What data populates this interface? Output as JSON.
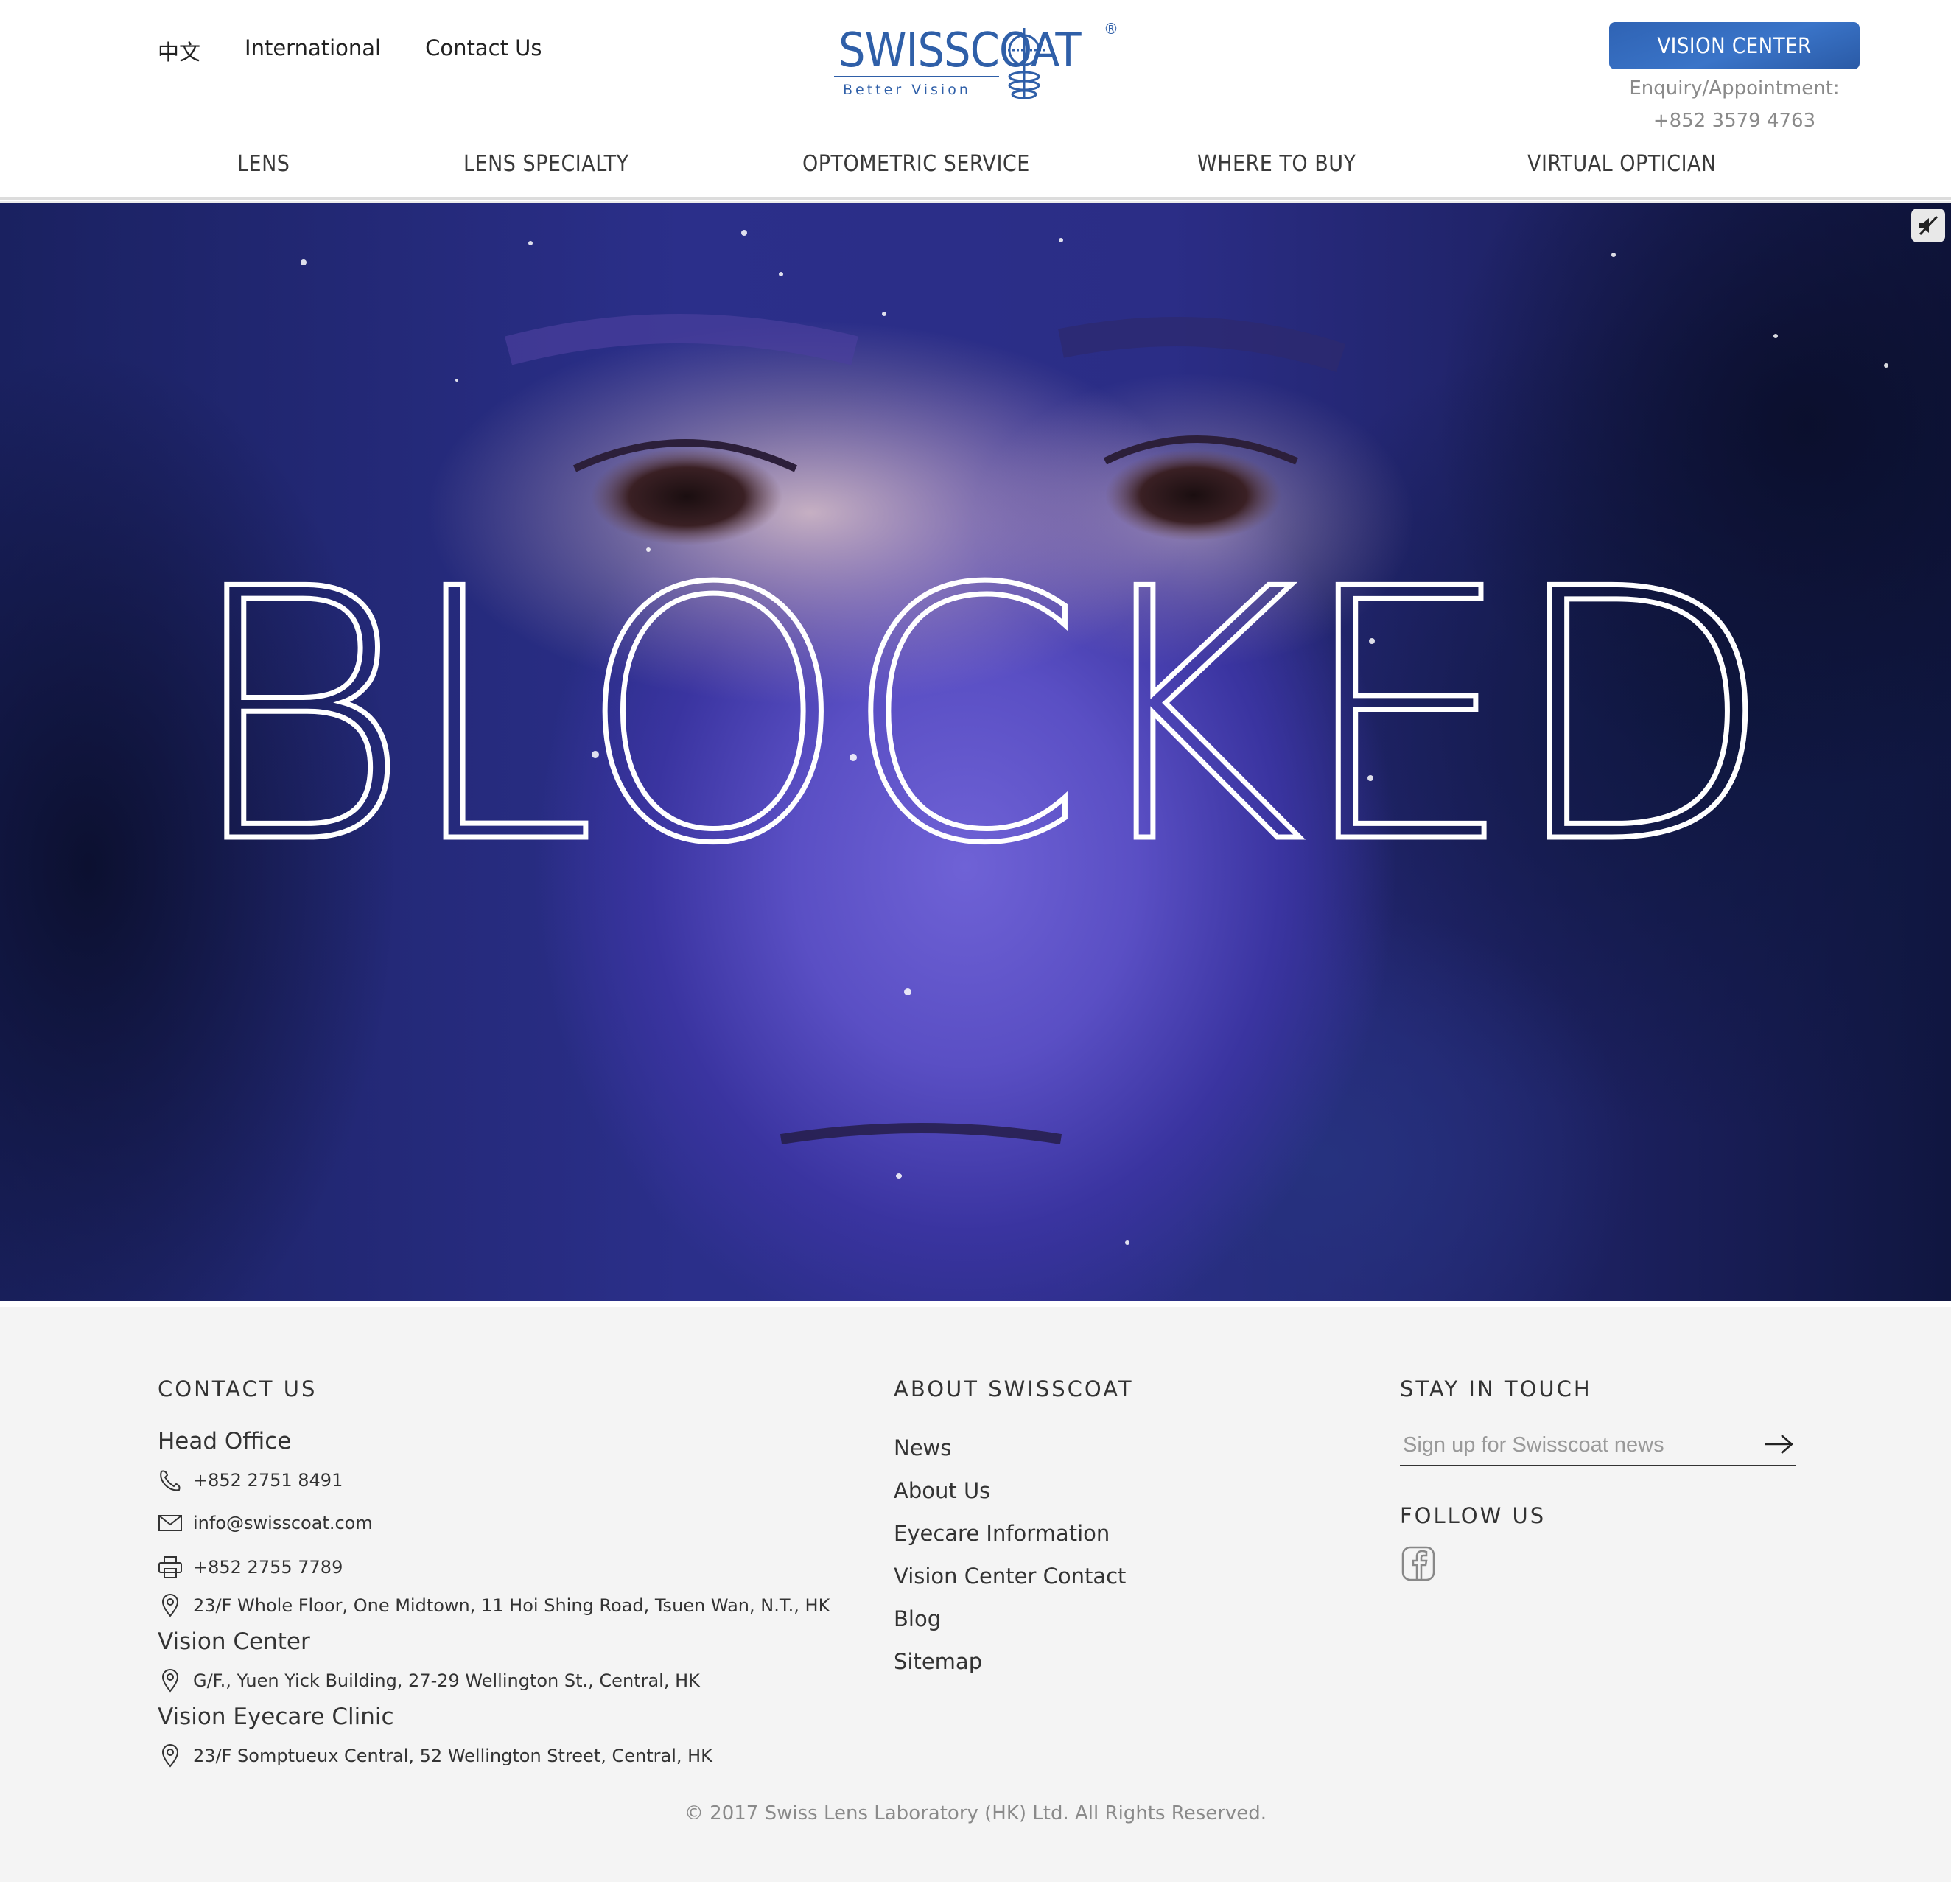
{
  "header": {
    "top_links": [
      "中文",
      "International",
      "Contact Us"
    ],
    "logo": {
      "brand": "SWISSCOAT",
      "tagline": "Better Vision",
      "mark": "®",
      "color": "#2f5fa8"
    },
    "vision_center_button": "VISION CENTER",
    "enquiry_label": "Enquiry/Appointment:",
    "enquiry_phone": "+852 3579 4763"
  },
  "nav": {
    "items": [
      "LENS",
      "LENS SPECIALTY",
      "OPTOMETRIC SERVICE",
      "WHERE TO BUY",
      "VIRTUAL OPTICIAN"
    ]
  },
  "hero": {
    "overlay_text": "BLOCKED",
    "mute_icon": "speaker-muted-icon",
    "accent": "#5a4fc4"
  },
  "footer": {
    "contact": {
      "heading": "CONTACT US",
      "head_office_title": "Head Office",
      "phone": "+852 2751 8491",
      "email": "info@swisscoat.com",
      "fax": "+852 2755 7789",
      "address": "23/F Whole Floor, One Midtown, 11 Hoi Shing Road, Tsuen Wan, N.T., HK",
      "vision_center_title": "Vision Center",
      "vision_center_address": "G/F., Yuen Yick Building, 27-29 Wellington St., Central, HK",
      "clinic_title": "Vision Eyecare Clinic",
      "clinic_address": "23/F Somptueux Central, 52 Wellington Street, Central, HK"
    },
    "about": {
      "heading": "ABOUT SWISSCOAT",
      "links": [
        "News",
        "About Us",
        "Eyecare Information",
        "Vision Center Contact",
        "Blog",
        "Sitemap"
      ]
    },
    "stay": {
      "heading": "STAY IN TOUCH",
      "signup_placeholder": "Sign up for Swisscoat news",
      "follow_heading": "FOLLOW US",
      "social_icon": "facebook-icon"
    },
    "copyright": "© 2017 Swiss Lens Laboratory (HK) Ltd. All Rights Reserved."
  }
}
